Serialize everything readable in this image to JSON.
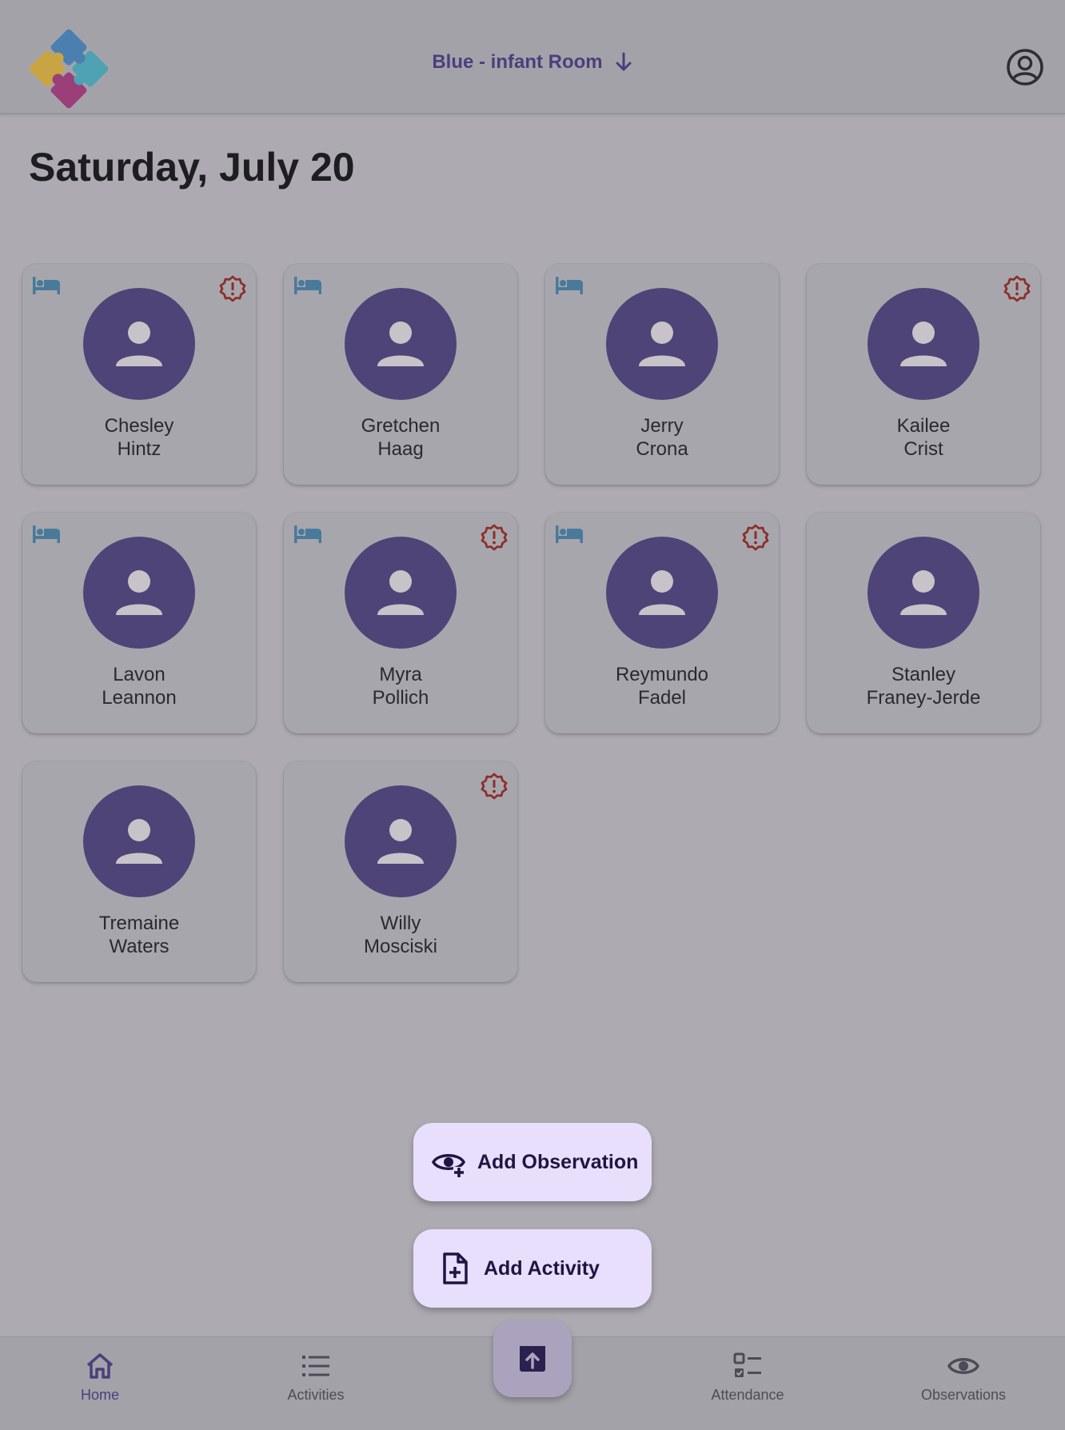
{
  "header": {
    "room_label": "Blue - infant Room",
    "logo_icon": "puzzle-logo",
    "account_icon": "account-circle-icon"
  },
  "page": {
    "title": "Saturday, July 20"
  },
  "children": [
    {
      "first": "Chesley",
      "last": "Hintz",
      "nap": true,
      "alert": true
    },
    {
      "first": "Gretchen",
      "last": "Haag",
      "nap": true,
      "alert": false
    },
    {
      "first": "Jerry",
      "last": "Crona",
      "nap": true,
      "alert": false
    },
    {
      "first": "Kailee",
      "last": "Crist",
      "nap": false,
      "alert": true
    },
    {
      "first": "Lavon",
      "last": "Leannon",
      "nap": true,
      "alert": false
    },
    {
      "first": "Myra",
      "last": "Pollich",
      "nap": true,
      "alert": true
    },
    {
      "first": "Reymundo",
      "last": "Fadel",
      "nap": true,
      "alert": true
    },
    {
      "first": "Stanley",
      "last": "Franey-Jerde",
      "nap": false,
      "alert": false
    },
    {
      "first": "Tremaine",
      "last": "Waters",
      "nap": false,
      "alert": false
    },
    {
      "first": "Willy",
      "last": "Mosciski",
      "nap": false,
      "alert": true
    }
  ],
  "fab_menu": {
    "add_observation": "Add Observation",
    "add_activity": "Add Activity"
  },
  "bottom_nav": {
    "home": "Home",
    "activities": "Activities",
    "attendance": "Attendance",
    "observations": "Observations"
  },
  "colors": {
    "accent": "#4b3f7c",
    "avatar": "#4f4477",
    "nap_icon": "#4a7a9a",
    "alert_icon": "#8c2f2a",
    "fab_bg": "#e8dffc"
  }
}
